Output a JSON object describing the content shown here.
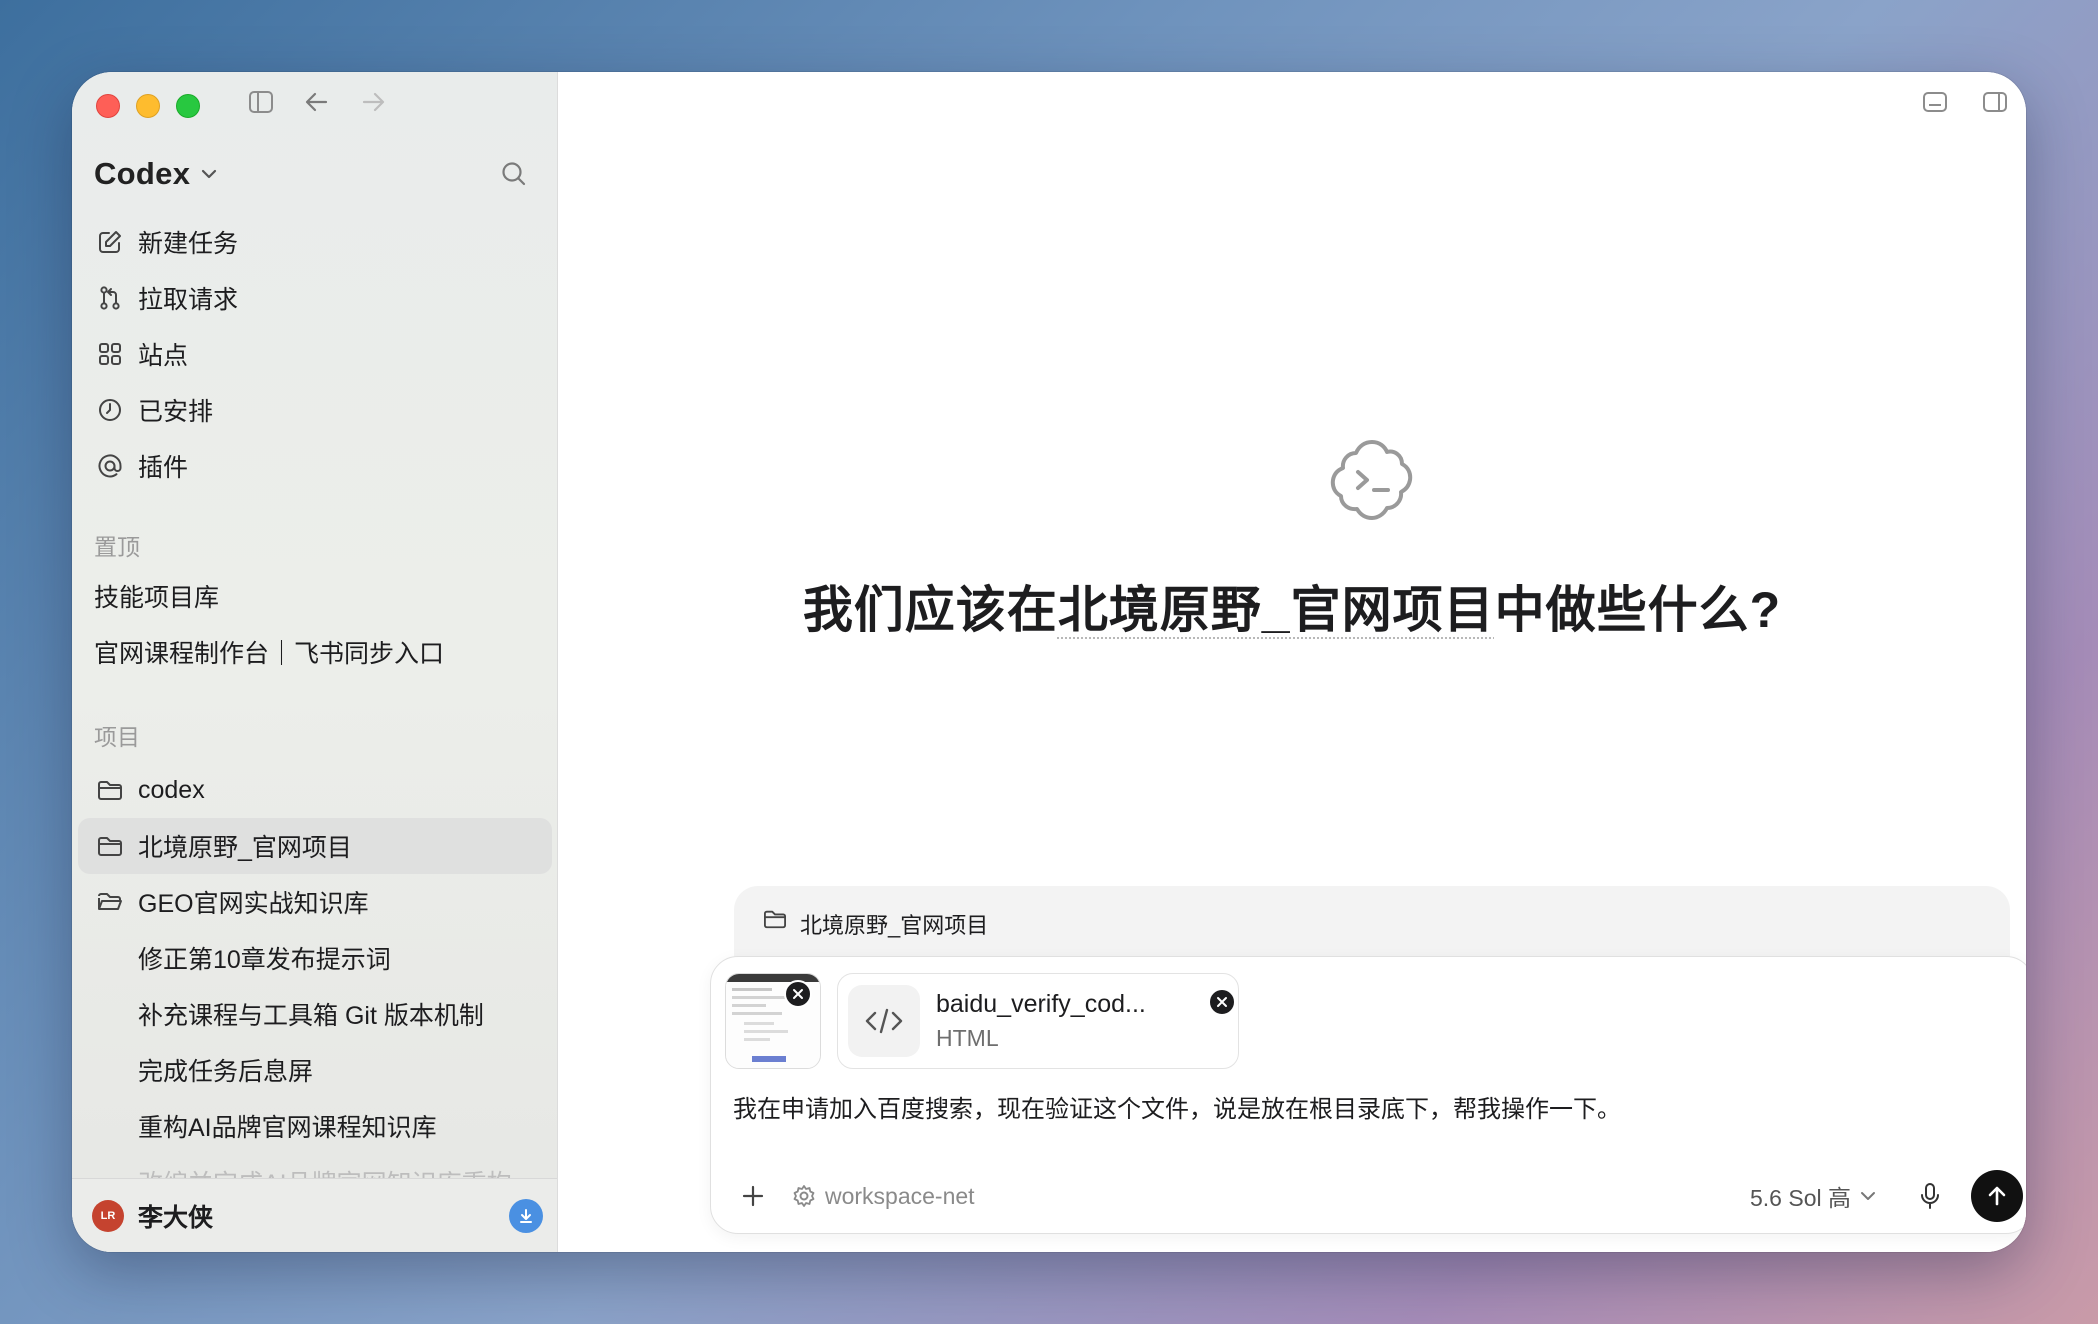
{
  "app": {
    "name": "Codex"
  },
  "sidebar": {
    "nav": [
      {
        "icon": "edit-icon",
        "label": "新建任务"
      },
      {
        "icon": "pull-request-icon",
        "label": "拉取请求"
      },
      {
        "icon": "grid-icon",
        "label": "站点"
      },
      {
        "icon": "clock-icon",
        "label": "已安排"
      },
      {
        "icon": "at-icon",
        "label": "插件"
      }
    ],
    "pinned_label": "置顶",
    "pinned": [
      "技能项目库",
      "官网课程制作台｜飞书同步入口"
    ],
    "projects_label": "项目",
    "projects": [
      {
        "label": "codex"
      },
      {
        "label": "北境原野_官网项目",
        "active": true
      },
      {
        "label": "GEO官网实战知识库"
      }
    ],
    "tasks": [
      "修正第10章发布提示词",
      "补充课程与工具箱 Git 版本机制",
      "完成任务后息屏",
      "重构AI品牌官网课程知识库",
      "改编并完成AI品牌官网知识库重构"
    ],
    "user": {
      "initials": "LR",
      "name": "李大侠"
    }
  },
  "main": {
    "hero_prefix": "我们应该在",
    "hero_project": "北境原野_官网项目",
    "hero_suffix": "中做些什么?",
    "context_project": "北境原野_官网项目",
    "attachment": {
      "name": "baidu_verify_cod...",
      "type": "HTML"
    },
    "prompt": "我在申请加入百度搜索，现在验证这个文件，说是放在根目录底下，帮我操作一下。",
    "workspace": "workspace-net",
    "model": "5.6 Sol 高"
  },
  "colors": {
    "accent": "#4a90e2",
    "send": "#111111",
    "avatar": "#c5432f"
  }
}
